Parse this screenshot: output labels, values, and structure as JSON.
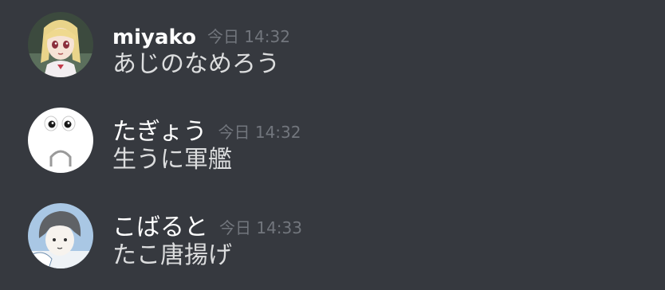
{
  "theme": {
    "background": "#36393f",
    "username_color": "#ffffff",
    "timestamp_color": "#72767d",
    "text_color": "#dcddde"
  },
  "messages": [
    {
      "username": "miyako",
      "timestamp": "今日 14:32",
      "content": "あじのなめろう",
      "avatar_icon": "anime-girl-avatar-icon"
    },
    {
      "username": "たぎょう",
      "timestamp": "今日 14:32",
      "content": "生うに軍艦",
      "avatar_icon": "googly-eyes-face-avatar-icon"
    },
    {
      "username": "こばると",
      "timestamp": "今日 14:33",
      "content": "たこ唐揚げ",
      "avatar_icon": "sketch-character-avatar-icon"
    }
  ]
}
